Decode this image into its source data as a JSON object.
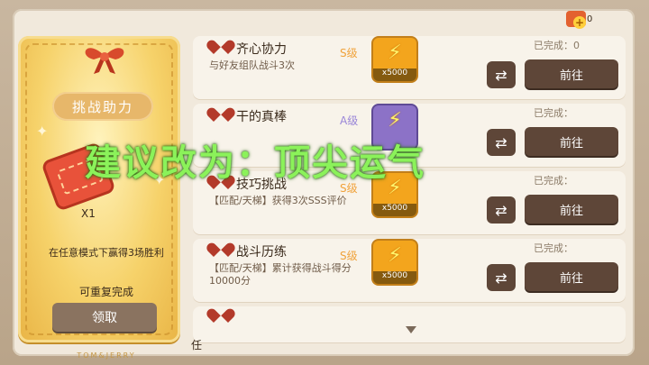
{
  "currency": {
    "count": "0"
  },
  "ticket": {
    "title": "挑战助力",
    "sub": "X1",
    "description": "在任意模式下赢得3场胜利",
    "repeat_text": "可重复完成",
    "claim_label": "领取",
    "brand": "TOM&JERRY"
  },
  "overlay_text": "建议改为：顶尖运气",
  "tasks": [
    {
      "name": "齐心协力",
      "desc": "与好友组队战斗3次",
      "grade": "S级",
      "grade_color": "#f0a23a",
      "reward_qty": "x5000",
      "reward_color": "#f3a51d",
      "done_label": "已完成：0",
      "action_label": "前往",
      "swap_icon": "swap-icon"
    },
    {
      "name": "干的真棒",
      "desc": "",
      "grade": "A级",
      "grade_color": "#9a86d8",
      "reward_qty": "",
      "reward_color": "#8c72c7",
      "done_label": "已完成：",
      "action_label": "前往",
      "swap_icon": "swap-icon"
    },
    {
      "name": "技巧挑战",
      "desc": "【匹配/天梯】获得3次SSS评价",
      "grade": "S级",
      "grade_color": "#f0a23a",
      "reward_qty": "x5000",
      "reward_color": "#f3a51d",
      "done_label": "已完成：",
      "action_label": "前往",
      "swap_icon": "swap-icon"
    },
    {
      "name": "战斗历练",
      "desc": "【匹配/天梯】累计获得战斗得分10000分",
      "grade": "S级",
      "grade_color": "#f0a23a",
      "reward_qty": "x5000",
      "reward_color": "#f3a51d",
      "done_label": "已完成：",
      "action_label": "前往",
      "swap_icon": "swap-icon"
    }
  ],
  "bottom_text": "任"
}
